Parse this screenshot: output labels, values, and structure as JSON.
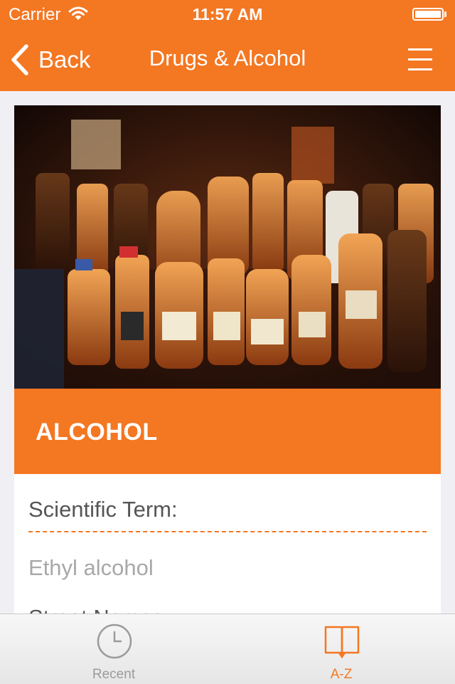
{
  "status_bar": {
    "carrier": "Carrier",
    "time": "11:57 AM",
    "wifi_icon": "wifi-icon",
    "battery_icon": "battery-icon"
  },
  "nav": {
    "back_label": "Back",
    "title": "Drugs & Alcohol",
    "menu_icon": "hamburger-menu-icon",
    "accent_color": "#f47722"
  },
  "card": {
    "image_subject": "Alcohol bottles photo",
    "title": "ALCOHOL",
    "scientific_term_label": "Scientific Term:",
    "scientific_term_value": "Ethyl alcohol",
    "street_names_label": "Street Names:"
  },
  "tab_bar": {
    "tabs": [
      {
        "label": "Recent",
        "icon": "clock-icon",
        "active": false
      },
      {
        "label": "A-Z",
        "icon": "book-icon",
        "active": true
      }
    ]
  }
}
